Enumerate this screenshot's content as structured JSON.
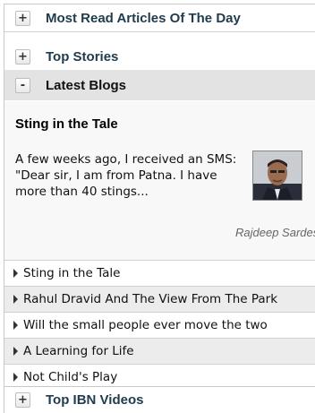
{
  "sections": {
    "most_read": {
      "toggle": "+",
      "title": "Most Read Articles Of The Day"
    },
    "top_stories": {
      "toggle": "+",
      "title": "Top Stories"
    },
    "latest_blogs": {
      "toggle": "-",
      "title": "Latest Blogs"
    },
    "top_ibn_videos": {
      "toggle": "+",
      "title": "Top IBN Videos"
    }
  },
  "featured_post": {
    "title": "Sting in the Tale",
    "excerpt": "A few weeks ago, I received an SMS: \"Dear sir, I am from Patna. I have more than 40 stings...",
    "author": "Rajdeep Sardesai",
    "thumbnail_icon": "author-portrait-icon"
  },
  "blog_list": [
    "Sting in the Tale",
    "Rahul Dravid And The View From The Park",
    "Will the small people ever move the two",
    "A Learning for Life",
    "Not Child's Play"
  ],
  "colors": {
    "section_title": "#1f3b4d",
    "expanded_header_bg": "#e3e3e3",
    "content_bg": "#f8f8f8",
    "list_shade": "#ececec"
  }
}
